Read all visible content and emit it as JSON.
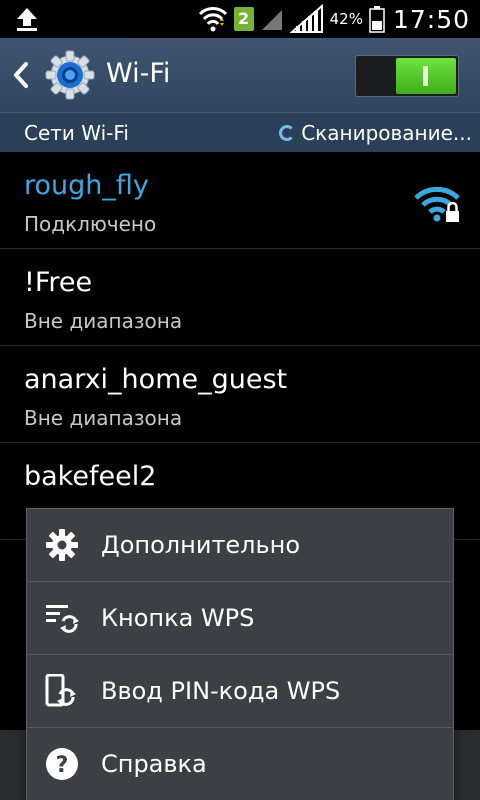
{
  "status_bar": {
    "sim_slot": "2",
    "battery_percent": "42%",
    "time": "17:50"
  },
  "action_bar": {
    "title": "Wi-Fi",
    "wifi_toggle_on": true
  },
  "subheader": {
    "title": "Сети Wi-Fi",
    "status": "Сканирование..."
  },
  "networks": [
    {
      "name": "rough_fly",
      "status": "Подключено",
      "connected": true
    },
    {
      "name": "!Free",
      "status": "Вне диапазона",
      "connected": false
    },
    {
      "name": "anarxi_home_guest",
      "status": "Вне диапазона",
      "connected": false
    },
    {
      "name": "bakefeel2",
      "status": "",
      "connected": false
    }
  ],
  "menu": {
    "items": [
      {
        "label": "Дополнительно",
        "icon": "gear-icon"
      },
      {
        "label": "Кнопка WPS",
        "icon": "wps-button-icon"
      },
      {
        "label": "Ввод PIN-кода WPS",
        "icon": "wps-pin-icon"
      },
      {
        "label": "Справка",
        "icon": "help-icon"
      }
    ]
  },
  "colors": {
    "connected": "#3ba9df",
    "toggle_on": "#4ec224",
    "action_bar": "#344a64"
  }
}
